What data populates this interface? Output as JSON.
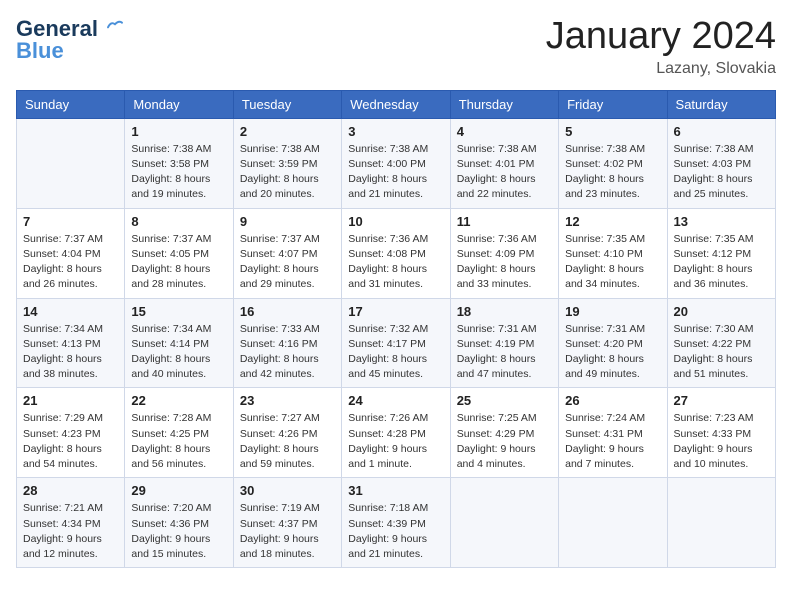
{
  "header": {
    "logo_line1": "General",
    "logo_line2": "Blue",
    "month": "January 2024",
    "location": "Lazany, Slovakia"
  },
  "weekdays": [
    "Sunday",
    "Monday",
    "Tuesday",
    "Wednesday",
    "Thursday",
    "Friday",
    "Saturday"
  ],
  "weeks": [
    [
      {
        "day": "",
        "info": ""
      },
      {
        "day": "1",
        "info": "Sunrise: 7:38 AM\nSunset: 3:58 PM\nDaylight: 8 hours\nand 19 minutes."
      },
      {
        "day": "2",
        "info": "Sunrise: 7:38 AM\nSunset: 3:59 PM\nDaylight: 8 hours\nand 20 minutes."
      },
      {
        "day": "3",
        "info": "Sunrise: 7:38 AM\nSunset: 4:00 PM\nDaylight: 8 hours\nand 21 minutes."
      },
      {
        "day": "4",
        "info": "Sunrise: 7:38 AM\nSunset: 4:01 PM\nDaylight: 8 hours\nand 22 minutes."
      },
      {
        "day": "5",
        "info": "Sunrise: 7:38 AM\nSunset: 4:02 PM\nDaylight: 8 hours\nand 23 minutes."
      },
      {
        "day": "6",
        "info": "Sunrise: 7:38 AM\nSunset: 4:03 PM\nDaylight: 8 hours\nand 25 minutes."
      }
    ],
    [
      {
        "day": "7",
        "info": "Sunrise: 7:37 AM\nSunset: 4:04 PM\nDaylight: 8 hours\nand 26 minutes."
      },
      {
        "day": "8",
        "info": "Sunrise: 7:37 AM\nSunset: 4:05 PM\nDaylight: 8 hours\nand 28 minutes."
      },
      {
        "day": "9",
        "info": "Sunrise: 7:37 AM\nSunset: 4:07 PM\nDaylight: 8 hours\nand 29 minutes."
      },
      {
        "day": "10",
        "info": "Sunrise: 7:36 AM\nSunset: 4:08 PM\nDaylight: 8 hours\nand 31 minutes."
      },
      {
        "day": "11",
        "info": "Sunrise: 7:36 AM\nSunset: 4:09 PM\nDaylight: 8 hours\nand 33 minutes."
      },
      {
        "day": "12",
        "info": "Sunrise: 7:35 AM\nSunset: 4:10 PM\nDaylight: 8 hours\nand 34 minutes."
      },
      {
        "day": "13",
        "info": "Sunrise: 7:35 AM\nSunset: 4:12 PM\nDaylight: 8 hours\nand 36 minutes."
      }
    ],
    [
      {
        "day": "14",
        "info": "Sunrise: 7:34 AM\nSunset: 4:13 PM\nDaylight: 8 hours\nand 38 minutes."
      },
      {
        "day": "15",
        "info": "Sunrise: 7:34 AM\nSunset: 4:14 PM\nDaylight: 8 hours\nand 40 minutes."
      },
      {
        "day": "16",
        "info": "Sunrise: 7:33 AM\nSunset: 4:16 PM\nDaylight: 8 hours\nand 42 minutes."
      },
      {
        "day": "17",
        "info": "Sunrise: 7:32 AM\nSunset: 4:17 PM\nDaylight: 8 hours\nand 45 minutes."
      },
      {
        "day": "18",
        "info": "Sunrise: 7:31 AM\nSunset: 4:19 PM\nDaylight: 8 hours\nand 47 minutes."
      },
      {
        "day": "19",
        "info": "Sunrise: 7:31 AM\nSunset: 4:20 PM\nDaylight: 8 hours\nand 49 minutes."
      },
      {
        "day": "20",
        "info": "Sunrise: 7:30 AM\nSunset: 4:22 PM\nDaylight: 8 hours\nand 51 minutes."
      }
    ],
    [
      {
        "day": "21",
        "info": "Sunrise: 7:29 AM\nSunset: 4:23 PM\nDaylight: 8 hours\nand 54 minutes."
      },
      {
        "day": "22",
        "info": "Sunrise: 7:28 AM\nSunset: 4:25 PM\nDaylight: 8 hours\nand 56 minutes."
      },
      {
        "day": "23",
        "info": "Sunrise: 7:27 AM\nSunset: 4:26 PM\nDaylight: 8 hours\nand 59 minutes."
      },
      {
        "day": "24",
        "info": "Sunrise: 7:26 AM\nSunset: 4:28 PM\nDaylight: 9 hours\nand 1 minute."
      },
      {
        "day": "25",
        "info": "Sunrise: 7:25 AM\nSunset: 4:29 PM\nDaylight: 9 hours\nand 4 minutes."
      },
      {
        "day": "26",
        "info": "Sunrise: 7:24 AM\nSunset: 4:31 PM\nDaylight: 9 hours\nand 7 minutes."
      },
      {
        "day": "27",
        "info": "Sunrise: 7:23 AM\nSunset: 4:33 PM\nDaylight: 9 hours\nand 10 minutes."
      }
    ],
    [
      {
        "day": "28",
        "info": "Sunrise: 7:21 AM\nSunset: 4:34 PM\nDaylight: 9 hours\nand 12 minutes."
      },
      {
        "day": "29",
        "info": "Sunrise: 7:20 AM\nSunset: 4:36 PM\nDaylight: 9 hours\nand 15 minutes."
      },
      {
        "day": "30",
        "info": "Sunrise: 7:19 AM\nSunset: 4:37 PM\nDaylight: 9 hours\nand 18 minutes."
      },
      {
        "day": "31",
        "info": "Sunrise: 7:18 AM\nSunset: 4:39 PM\nDaylight: 9 hours\nand 21 minutes."
      },
      {
        "day": "",
        "info": ""
      },
      {
        "day": "",
        "info": ""
      },
      {
        "day": "",
        "info": ""
      }
    ]
  ]
}
